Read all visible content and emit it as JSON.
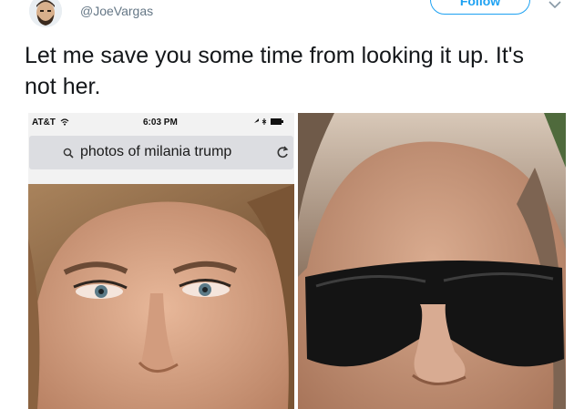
{
  "tweet": {
    "handle": "@JoeVargas",
    "follow_label": "Follow",
    "text": "Let me save you some time from looking it up. It's not her."
  },
  "phone_screenshot": {
    "carrier": "AT&T",
    "time": "6:03 PM",
    "search_query": "photos of milania trump"
  },
  "icons": {
    "avatar": "bearded-man-avatar",
    "caret": "chevron-down-icon",
    "wifi": "wifi-icon",
    "search": "search-icon",
    "reload": "reload-icon"
  },
  "colors": {
    "accent": "#1da1f2",
    "handle_gray": "#657786",
    "search_bar_bg": "#dcdde1"
  }
}
